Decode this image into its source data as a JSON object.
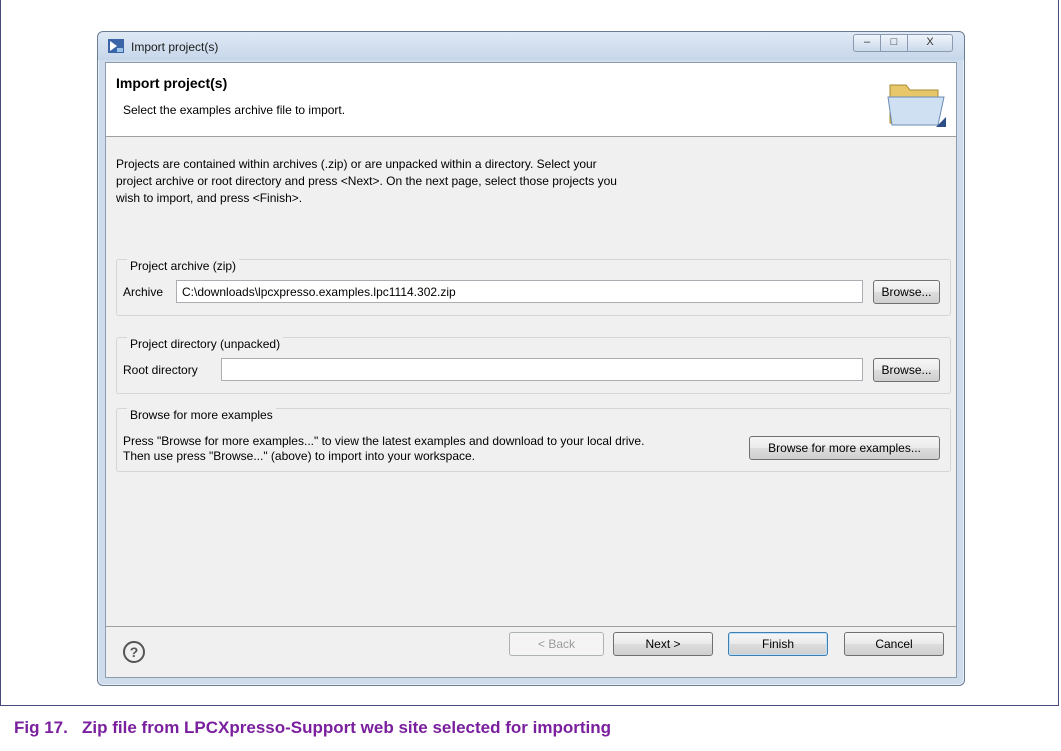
{
  "window": {
    "title": "Import project(s)",
    "icons": {
      "app": "eclipse-app-icon",
      "minimize": "minimize-icon",
      "maximize": "maximize-icon",
      "close": "close-icon"
    },
    "controls": {
      "min": "–",
      "max": "□",
      "close": "X"
    }
  },
  "header": {
    "title": "Import project(s)",
    "subtitle": "Select the examples archive file to import.",
    "icon": "folder-icon"
  },
  "intro": {
    "line1": "Projects are contained within archives (.zip) or are unpacked within a directory. Select your",
    "line2": "project archive or root directory and press <Next>. On the next page, select those projects you",
    "line3": "wish to import, and press <Finish>."
  },
  "archive_group": {
    "label": "Project archive (zip)",
    "field_label": "Archive",
    "value": "C:\\downloads\\lpcxpresso.examples.lpc1114.302.zip",
    "browse_label": "Browse..."
  },
  "directory_group": {
    "label": "Project directory (unpacked)",
    "field_label": "Root directory",
    "value": "",
    "browse_label": "Browse..."
  },
  "examples_group": {
    "label": "Browse for more examples",
    "text1": "Press \"Browse for more examples...\" to view the latest examples and download to your local drive.",
    "text2": "Then use press \"Browse...\" (above) to import into your workspace.",
    "button_label": "Browse for more examples..."
  },
  "footer": {
    "help_icon": "help-icon",
    "help_glyph": "?",
    "back_label": "< Back",
    "next_label": "Next >",
    "finish_label": "Finish",
    "cancel_label": "Cancel"
  },
  "caption": {
    "label": "Fig 17.",
    "text": "Zip file from LPCXpresso-Support web site selected for importing"
  },
  "colors": {
    "caption": "#7a1f9e",
    "window_frame": "#cfdcec",
    "dialog_bg": "#f0f0f0"
  }
}
